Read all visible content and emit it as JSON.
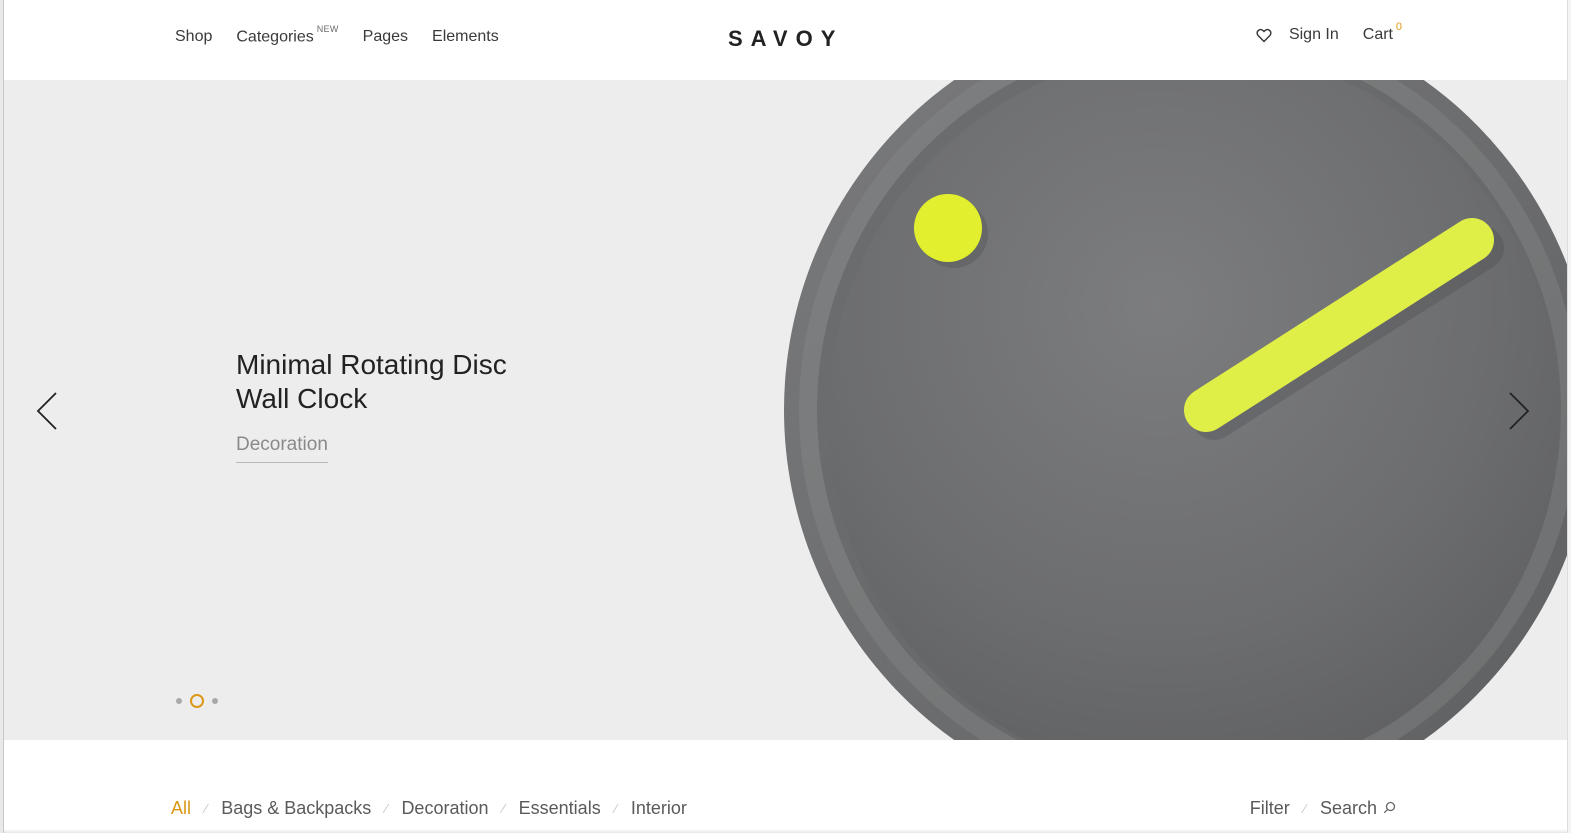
{
  "header": {
    "nav": [
      {
        "label": "Shop"
      },
      {
        "label": "Categories",
        "badge": "NEW"
      },
      {
        "label": "Pages"
      },
      {
        "label": "Elements"
      }
    ],
    "logo": "SAVOY",
    "wishlist_icon": "heart-icon",
    "sign_in": "Sign In",
    "cart_label": "Cart",
    "cart_count": "0"
  },
  "hero": {
    "title": "Minimal Rotating Disc Wall Clock",
    "category": "Decoration",
    "prev_icon": "chevron-left-icon",
    "next_icon": "chevron-right-icon",
    "slide_count": 3,
    "active_slide": 2,
    "accent_color": "#dc9814",
    "background_color": "#ededed",
    "clock_color": "#6d6e70",
    "hand_color": "#e2f03b"
  },
  "filters": {
    "categories": [
      "All",
      "Bags & Backpacks",
      "Decoration",
      "Essentials",
      "Interior"
    ],
    "active": "All",
    "separator": "⁄",
    "filter_label": "Filter",
    "search_label": "Search"
  }
}
